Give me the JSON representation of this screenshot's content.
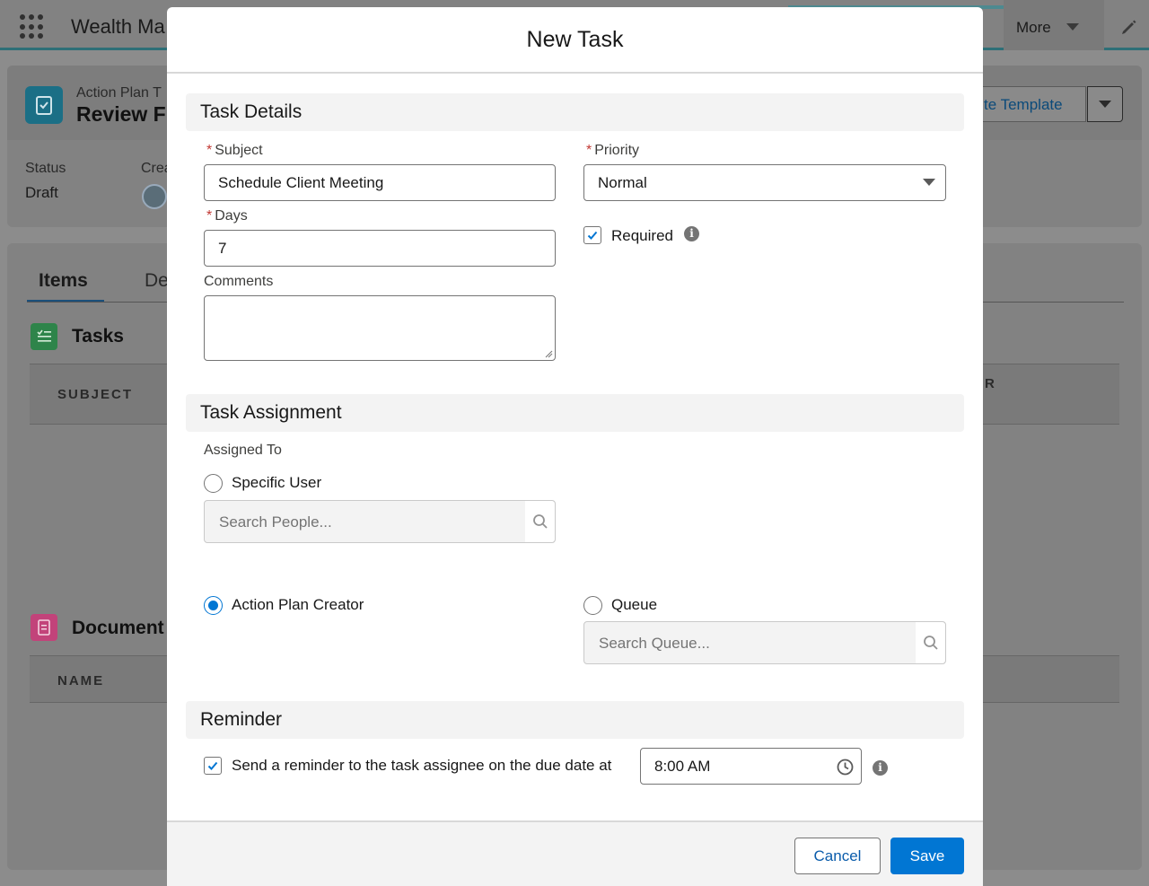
{
  "background": {
    "app_name": "Wealth Ma",
    "nav_more_label": "More",
    "record": {
      "type_label": "Action Plan T",
      "name": "Review Fi",
      "action_button_label": "te Template",
      "status_label": "Status",
      "status_value": "Draft",
      "created_by_label": "Crea"
    },
    "tabs": [
      {
        "label": "Items"
      },
      {
        "label": "De"
      }
    ],
    "sections": [
      {
        "title": "Tasks",
        "column_header": "SUBJECT",
        "right_header": "R"
      },
      {
        "title": "Document",
        "column_header": "NAME"
      }
    ]
  },
  "modal": {
    "title": "New Task",
    "task_details": {
      "heading": "Task Details",
      "subject_label": "Subject",
      "subject_value": "Schedule Client Meeting",
      "priority_label": "Priority",
      "priority_value": "Normal",
      "days_label": "Days",
      "days_value": "7",
      "required_label": "Required",
      "required_checked": true,
      "comments_label": "Comments",
      "comments_value": ""
    },
    "task_assignment": {
      "heading": "Task Assignment",
      "assigned_to_label": "Assigned To",
      "options": [
        {
          "label": "Specific User",
          "selected": false
        },
        {
          "label": "Action Plan Creator",
          "selected": true
        },
        {
          "label": "Queue",
          "selected": false
        }
      ],
      "people_search_placeholder": "Search People...",
      "queue_search_placeholder": "Search Queue..."
    },
    "reminder": {
      "heading": "Reminder",
      "checkbox_label": "Send a reminder to the task assignee on the due date at",
      "checked": true,
      "time_value": "8:00 AM"
    },
    "footer": {
      "cancel_label": "Cancel",
      "save_label": "Save"
    }
  },
  "colors": {
    "brand": "#0176d3",
    "required": "#c23934",
    "section_bg": "#f3f3f3"
  }
}
